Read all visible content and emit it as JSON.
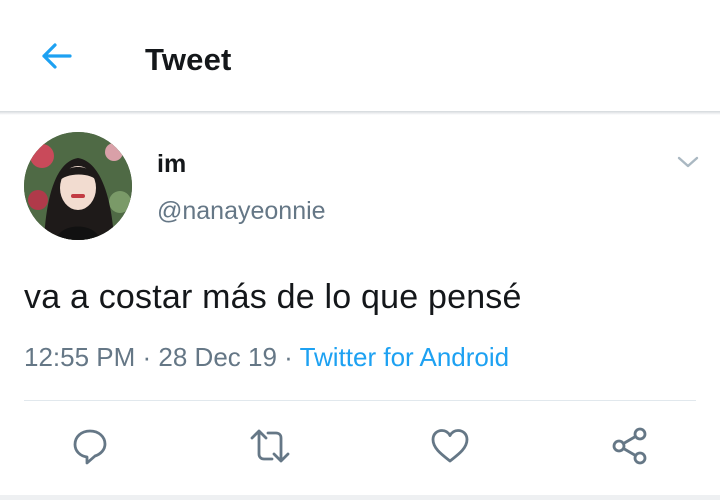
{
  "header": {
    "title": "Tweet",
    "back_icon": "arrow-left-icon",
    "accent_color": "#1da1f2"
  },
  "tweet": {
    "author_name": "im",
    "author_handle": "@nanayeonnie",
    "text": "va a costar más de lo que pensé",
    "time": "12:55 PM",
    "separator": " · ",
    "date": "28 Dec 19",
    "source": "Twitter for Android",
    "menu_icon": "chevron-down-icon"
  },
  "actions": [
    {
      "name": "reply",
      "icon": "comment-icon"
    },
    {
      "name": "retweet",
      "icon": "retweet-icon"
    },
    {
      "name": "like",
      "icon": "heart-icon"
    },
    {
      "name": "share",
      "icon": "share-icon"
    }
  ],
  "colors": {
    "text": "#14171a",
    "secondary": "#657786",
    "icon": "#657786",
    "divider": "#e1e8ed"
  }
}
